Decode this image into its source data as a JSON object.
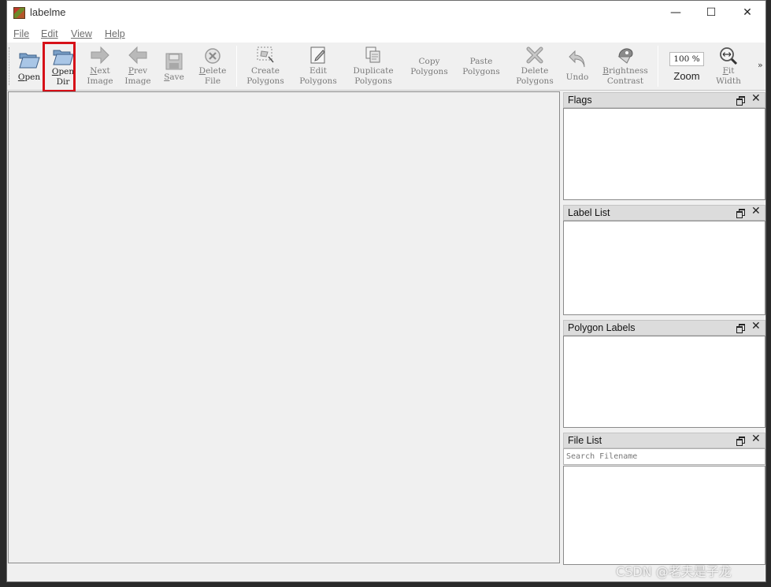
{
  "window": {
    "title": "labelme",
    "controls": {
      "minimize": "—",
      "maximize": "☐",
      "close": "✕"
    }
  },
  "menu": [
    {
      "label": "File"
    },
    {
      "label": "Edit"
    },
    {
      "label": "View"
    },
    {
      "label": "Help"
    }
  ],
  "toolbar": {
    "open": {
      "label": "Open",
      "icon": "folder-open-icon"
    },
    "open_dir": {
      "label": "Open\nDir",
      "icon": "folder-open-icon",
      "highlighted": true,
      "highlight_color": "#d61018"
    },
    "next_image": {
      "label": "Next\nImage",
      "icon": "arrow-right-icon"
    },
    "prev_image": {
      "label": "Prev\nImage",
      "icon": "arrow-left-icon"
    },
    "save": {
      "label": "Save",
      "icon": "floppy-disk-icon"
    },
    "delete_file": {
      "label": "Delete\nFile",
      "icon": "circle-x-icon"
    },
    "create_polygons": {
      "label": "Create\nPolygons",
      "icon": "polygon-create-icon"
    },
    "edit_polygons": {
      "label": "Edit\nPolygons",
      "icon": "pencil-doc-icon"
    },
    "duplicate_polygons": {
      "label": "Duplicate\nPolygons",
      "icon": "duplicate-icon"
    },
    "copy_polygons": {
      "label": "Copy\nPolygons"
    },
    "paste_polygons": {
      "label": "Paste\nPolygons"
    },
    "delete_polygons": {
      "label": "Delete\nPolygons",
      "icon": "big-x-icon"
    },
    "undo": {
      "label": "Undo",
      "icon": "undo-arrow-icon"
    },
    "brightness_contrast": {
      "label": "Brightness\nContrast",
      "icon": "brightness-icon"
    },
    "zoom": {
      "value": "100 %",
      "label": "Zoom"
    },
    "fit_width": {
      "label": "Fit\nWidth",
      "icon": "zoom-fit-icon"
    },
    "more": "»"
  },
  "docks": {
    "flags": {
      "title": "Flags"
    },
    "label_list": {
      "title": "Label List"
    },
    "polygon_labels": {
      "title": "Polygon Labels"
    },
    "file_list": {
      "title": "File List",
      "search_placeholder": "Search Filename"
    }
  },
  "dock_close_glyph": "✕",
  "watermark": "CSDN @老夫是子龙"
}
